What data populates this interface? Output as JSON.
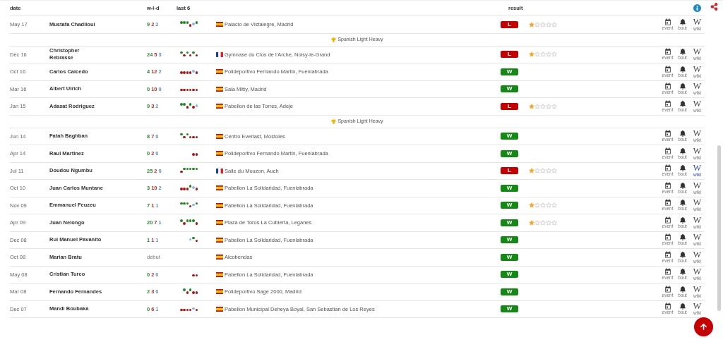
{
  "header": {
    "date": "date",
    "wld": "w-l-d",
    "last6": "last 6",
    "result": "result"
  },
  "rows": [
    {
      "kind": "bout",
      "date": "May 17",
      "name": "Mustafa Chadlioui",
      "wld": {
        "w": "9",
        "l": "2",
        "d": "2"
      },
      "last6": [
        {
          "kind": "win"
        },
        {
          "kind": "win"
        },
        {
          "kind": "win"
        },
        {
          "kind": "loss"
        },
        {
          "kind": "draw"
        },
        {
          "kind": "win"
        }
      ],
      "flag": {
        "kind": "es"
      },
      "location": "Palacio de Vistalegre, Madrid",
      "result": {
        "label": "L",
        "kind": "loss"
      },
      "stars": 1,
      "links": [
        {
          "kind": "event",
          "label": "event"
        },
        {
          "kind": "bout",
          "label": "bout"
        },
        {
          "kind": "wiki",
          "glyph": "W",
          "label": "wiki",
          "highlighted": false
        }
      ]
    },
    {
      "kind": "title",
      "label": "Spanish Light Heavy"
    },
    {
      "kind": "bout",
      "date": "Dec 16",
      "name": "Christopher Rebrasse",
      "wld": {
        "w": "24",
        "l": "5",
        "d": "3"
      },
      "last6": [
        {
          "kind": "win"
        },
        {
          "kind": "loss"
        },
        {
          "kind": "win"
        },
        {
          "kind": "loss"
        },
        {
          "kind": "win"
        },
        {
          "kind": "loss"
        }
      ],
      "flag": {
        "kind": "fr"
      },
      "location": "Gymnase du Clos de l'Arche, Noisy-le-Grand",
      "result": {
        "label": "L",
        "kind": "loss"
      },
      "stars": 1,
      "links": [
        {
          "kind": "event",
          "label": "event"
        },
        {
          "kind": "bout",
          "label": "bout"
        },
        {
          "kind": "wiki",
          "glyph": "W",
          "label": "wiki",
          "highlighted": false
        }
      ]
    },
    {
      "kind": "bout",
      "date": "Oct 16",
      "name": "Carlos Caicedo",
      "wld": {
        "w": "4",
        "l": "12",
        "d": "2"
      },
      "last6": [
        {
          "kind": "loss"
        },
        {
          "kind": "loss"
        },
        {
          "kind": "loss"
        },
        {
          "kind": "loss"
        },
        {
          "kind": "draw"
        },
        {
          "kind": "loss"
        }
      ],
      "flag": {
        "kind": "es"
      },
      "location": "Polideportivo Fernando Martin, Fuenlabrada",
      "result": {
        "label": "W",
        "kind": "win"
      },
      "links": [
        {
          "kind": "event",
          "label": "event"
        },
        {
          "kind": "bout",
          "label": "bout"
        },
        {
          "kind": "wiki",
          "glyph": "W",
          "label": "wiki",
          "highlighted": false
        }
      ]
    },
    {
      "kind": "bout",
      "date": "Mar 16",
      "name": "Albert Ulrich",
      "wld": {
        "w": "0",
        "l": "10",
        "d": "0"
      },
      "last6": [
        {
          "kind": "loss"
        },
        {
          "kind": "loss"
        },
        {
          "kind": "loss"
        },
        {
          "kind": "loss"
        },
        {
          "kind": "loss"
        },
        {
          "kind": "loss"
        }
      ],
      "flag": {
        "kind": "es"
      },
      "location": "Sala Mitty, Madrid",
      "result": {
        "label": "W",
        "kind": "win"
      },
      "links": [
        {
          "kind": "event",
          "label": "event"
        },
        {
          "kind": "bout",
          "label": "bout"
        },
        {
          "kind": "wiki",
          "glyph": "W",
          "label": "wiki",
          "highlighted": false
        }
      ]
    },
    {
      "kind": "bout",
      "date": "Jan 15",
      "name": "Adasat Rodriguez",
      "wld": {
        "w": "9",
        "l": "3",
        "d": "2"
      },
      "last6": [
        {
          "kind": "win"
        },
        {
          "kind": "win"
        },
        {
          "kind": "loss"
        },
        {
          "kind": "win"
        },
        {
          "kind": "loss"
        },
        {
          "kind": "draw"
        }
      ],
      "flag": {
        "kind": "es"
      },
      "location": "Pabellon de las Torres, Adeje",
      "result": {
        "label": "L",
        "kind": "loss"
      },
      "stars": 1,
      "links": [
        {
          "kind": "event",
          "label": "event"
        },
        {
          "kind": "bout",
          "label": "bout"
        },
        {
          "kind": "wiki",
          "glyph": "W",
          "label": "wiki",
          "highlighted": false
        }
      ]
    },
    {
      "kind": "title",
      "label": "Spanish Light Heavy"
    },
    {
      "kind": "bout",
      "date": "Jun 14",
      "name": "Fatah Baghban",
      "wld": {
        "w": "8",
        "l": "7",
        "d": "0"
      },
      "last6": [
        {
          "kind": "win"
        },
        {
          "kind": "loss"
        },
        {
          "kind": "win"
        },
        {
          "kind": "loss"
        },
        {
          "kind": "loss"
        },
        {
          "kind": "loss"
        }
      ],
      "flag": {
        "kind": "es"
      },
      "location": "Centro Everlast, Mostoles",
      "result": {
        "label": "W",
        "kind": "win"
      },
      "links": [
        {
          "kind": "event",
          "label": "event"
        },
        {
          "kind": "bout",
          "label": "bout"
        },
        {
          "kind": "wiki",
          "glyph": "W",
          "label": "wiki",
          "highlighted": false
        }
      ]
    },
    {
      "kind": "bout",
      "date": "Apr 14",
      "name": "Raul Martinez",
      "wld": {
        "w": "0",
        "l": "2",
        "d": "0"
      },
      "last6": [
        {
          "kind": "loss"
        },
        {
          "kind": "loss"
        }
      ],
      "flag": {
        "kind": "es"
      },
      "location": "Polideportivo Fernando Martin, Fuenlabrada",
      "result": {
        "label": "W",
        "kind": "win"
      },
      "links": [
        {
          "kind": "event",
          "label": "event"
        },
        {
          "kind": "bout",
          "label": "bout"
        },
        {
          "kind": "wiki",
          "glyph": "W",
          "label": "wiki",
          "highlighted": false
        }
      ]
    },
    {
      "kind": "bout",
      "date": "Jul 11",
      "name": "Doudou Ngumbu",
      "wld": {
        "w": "25",
        "l": "2",
        "d": "0"
      },
      "last6": [
        {
          "kind": "loss"
        },
        {
          "kind": "win"
        },
        {
          "kind": "win"
        },
        {
          "kind": "win"
        },
        {
          "kind": "win"
        },
        {
          "kind": "win"
        }
      ],
      "flag": {
        "kind": "fr"
      },
      "location": "Salle du Mouzon, Auch",
      "result": {
        "label": "L",
        "kind": "loss"
      },
      "stars": 1,
      "links": [
        {
          "kind": "event",
          "label": "event"
        },
        {
          "kind": "bout",
          "label": "bout"
        },
        {
          "kind": "wiki",
          "glyph": "W",
          "label": "wiki",
          "highlighted": true
        }
      ]
    },
    {
      "kind": "bout",
      "date": "Oct 10",
      "name": "Juan Carlos Muntane",
      "wld": {
        "w": "3",
        "l": "10",
        "d": "2"
      },
      "last6": [
        {
          "kind": "loss"
        },
        {
          "kind": "loss"
        },
        {
          "kind": "loss"
        },
        {
          "kind": "win"
        },
        {
          "kind": "draw"
        },
        {
          "kind": "loss"
        }
      ],
      "flag": {
        "kind": "es"
      },
      "location": "Pabellon La Solidaridad, Fuenlabrada",
      "result": {
        "label": "W",
        "kind": "win"
      },
      "links": [
        {
          "kind": "event",
          "label": "event"
        },
        {
          "kind": "bout",
          "label": "bout"
        },
        {
          "kind": "wiki",
          "glyph": "W",
          "label": "wiki",
          "highlighted": false
        }
      ]
    },
    {
      "kind": "bout",
      "date": "Nov 09",
      "name": "Emmanuel Feuzeu",
      "wld": {
        "w": "7",
        "l": "1",
        "d": "1"
      },
      "last6": [
        {
          "kind": "win"
        },
        {
          "kind": "win"
        },
        {
          "kind": "win"
        },
        {
          "kind": "loss"
        },
        {
          "kind": "draw"
        },
        {
          "kind": "win"
        }
      ],
      "flag": {
        "kind": "es"
      },
      "location": "Pabellon La Solidaridad, Fuenlabrada",
      "result": {
        "label": "W",
        "kind": "win"
      },
      "stars": 1,
      "links": [
        {
          "kind": "event",
          "label": "event"
        },
        {
          "kind": "bout",
          "label": "bout"
        },
        {
          "kind": "wiki",
          "glyph": "W",
          "label": "wiki",
          "highlighted": false
        }
      ]
    },
    {
      "kind": "bout",
      "date": "Apr 09",
      "name": "Juan Nelongo",
      "wld": {
        "w": "20",
        "l": "7",
        "d": "1"
      },
      "last6": [
        {
          "kind": "win"
        },
        {
          "kind": "loss"
        },
        {
          "kind": "win"
        },
        {
          "kind": "win"
        },
        {
          "kind": "win"
        },
        {
          "kind": "loss"
        }
      ],
      "flag": {
        "kind": "es"
      },
      "location": "Plaza de Toros La Cubierta, Leganes",
      "result": {
        "label": "W",
        "kind": "win"
      },
      "stars": 1,
      "links": [
        {
          "kind": "event",
          "label": "event"
        },
        {
          "kind": "bout",
          "label": "bout"
        },
        {
          "kind": "wiki",
          "glyph": "W",
          "label": "wiki",
          "highlighted": false
        }
      ]
    },
    {
      "kind": "bout",
      "date": "Dec 08",
      "name": "Rui Manuel Pavanito",
      "wld": {
        "w": "1",
        "l": "1",
        "d": "1"
      },
      "last6": [
        {
          "kind": "draw"
        },
        {
          "kind": "win"
        },
        {
          "kind": "loss"
        }
      ],
      "flag": {
        "kind": "es"
      },
      "location": "Pabellon La Solidaridad, Fuenlabrada",
      "result": {
        "label": "W",
        "kind": "win"
      },
      "links": [
        {
          "kind": "event",
          "label": "event"
        },
        {
          "kind": "bout",
          "label": "bout"
        },
        {
          "kind": "wiki",
          "glyph": "W",
          "label": "wiki",
          "highlighted": false
        }
      ]
    },
    {
      "kind": "bout",
      "date": "Oct 08",
      "name": "Marian Bratu",
      "record_note": "debut",
      "flag": {
        "kind": "es"
      },
      "location": "Alcobendas",
      "result": {
        "label": "W",
        "kind": "win"
      },
      "links": [
        {
          "kind": "event",
          "label": "event"
        },
        {
          "kind": "bout",
          "label": "bout"
        },
        {
          "kind": "wiki",
          "glyph": "W",
          "label": "wiki",
          "highlighted": false
        }
      ]
    },
    {
      "kind": "bout",
      "date": "May 08",
      "name": "Cristian Turco",
      "wld": {
        "w": "0",
        "l": "2",
        "d": "0"
      },
      "last6": [
        {
          "kind": "loss"
        },
        {
          "kind": "loss"
        }
      ],
      "flag": {
        "kind": "es"
      },
      "location": "Pabellon La Solidaridad, Fuenlabrada",
      "result": {
        "label": "W",
        "kind": "win"
      },
      "links": [
        {
          "kind": "event",
          "label": "event"
        },
        {
          "kind": "bout",
          "label": "bout"
        },
        {
          "kind": "wiki",
          "glyph": "W",
          "label": "wiki",
          "highlighted": false
        }
      ]
    },
    {
      "kind": "bout",
      "date": "Mar 08",
      "name": "Fernando Fernandes",
      "wld": {
        "w": "2",
        "l": "3",
        "d": "0"
      },
      "last6": [
        {
          "kind": "win"
        },
        {
          "kind": "loss"
        },
        {
          "kind": "win"
        },
        {
          "kind": "loss"
        },
        {
          "kind": "loss"
        }
      ],
      "flag": {
        "kind": "es"
      },
      "location": "Polideportivo Sage 2000, Madrid",
      "result": {
        "label": "W",
        "kind": "win"
      },
      "links": [
        {
          "kind": "event",
          "label": "event"
        },
        {
          "kind": "bout",
          "label": "bout"
        },
        {
          "kind": "wiki",
          "glyph": "W",
          "label": "wiki",
          "highlighted": false
        }
      ]
    },
    {
      "kind": "bout",
      "date": "Dec 07",
      "name": "Mandi Boubaka",
      "wld": {
        "w": "0",
        "l": "6",
        "d": "1"
      },
      "last6": [
        {
          "kind": "loss"
        },
        {
          "kind": "loss"
        },
        {
          "kind": "loss"
        },
        {
          "kind": "loss"
        },
        {
          "kind": "draw"
        },
        {
          "kind": "loss"
        }
      ],
      "flag": {
        "kind": "es"
      },
      "location": "Pabellon Municipal Deheya Boyal, San Sebastian de Los Reyes",
      "result": {
        "label": "W",
        "kind": "win"
      },
      "links": [
        {
          "kind": "event",
          "label": "event"
        },
        {
          "kind": "bout",
          "label": "bout"
        },
        {
          "kind": "wiki",
          "glyph": "W",
          "label": "wiki",
          "highlighted": false
        }
      ]
    }
  ]
}
